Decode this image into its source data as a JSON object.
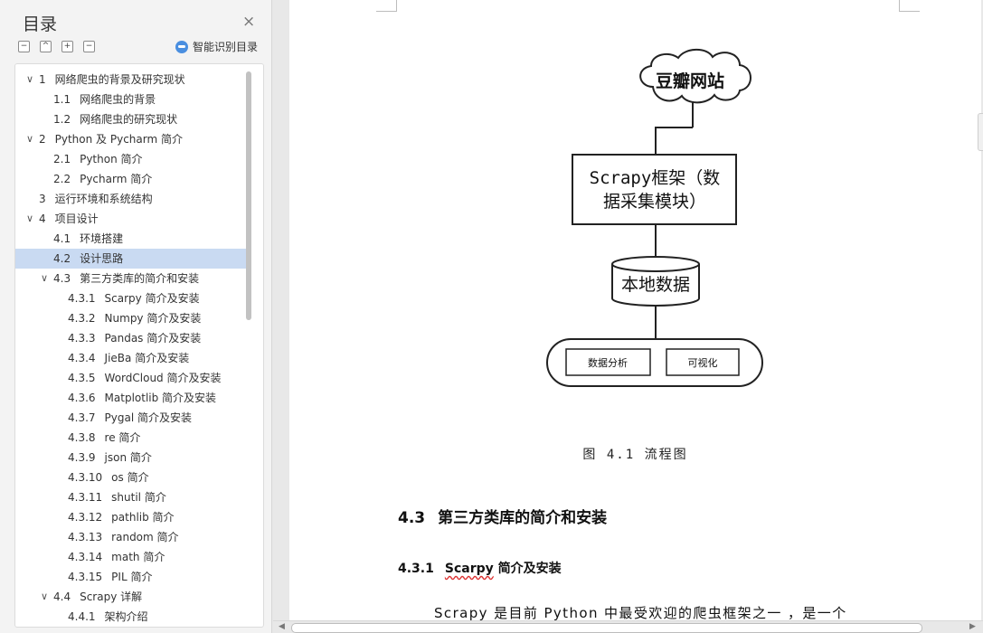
{
  "toc": {
    "title": "目录",
    "close_glyph": "×",
    "toolbar": {
      "collapse": "−",
      "up": "^",
      "expand": "+",
      "remove": "−"
    },
    "smart_label": "智能识别目录",
    "items": [
      {
        "level": 1,
        "chev": "∨",
        "num": "1",
        "label": "网络爬虫的背景及研究现状"
      },
      {
        "level": 2,
        "chev": "",
        "num": "1.1",
        "label": "网络爬虫的背景"
      },
      {
        "level": 2,
        "chev": "",
        "num": "1.2",
        "label": "网络爬虫的研究现状"
      },
      {
        "level": 1,
        "chev": "∨",
        "num": "2",
        "label": "Python 及 Pycharm 简介"
      },
      {
        "level": 2,
        "chev": "",
        "num": "2.1",
        "label": "Python 简介"
      },
      {
        "level": 2,
        "chev": "",
        "num": "2.2",
        "label": "Pycharm 简介"
      },
      {
        "level": 1,
        "chev": "",
        "num": "3",
        "label": "运行环境和系统结构"
      },
      {
        "level": 1,
        "chev": "∨",
        "num": "4",
        "label": "项目设计"
      },
      {
        "level": 2,
        "chev": "",
        "num": "4.1",
        "label": "环境搭建"
      },
      {
        "level": 2,
        "chev": "",
        "num": "4.2",
        "label": "设计思路",
        "selected": true
      },
      {
        "level": 2,
        "chev": "∨",
        "num": "4.3",
        "label": "第三方类库的简介和安装"
      },
      {
        "level": 3,
        "chev": "",
        "num": "4.3.1",
        "label": "Scarpy 简介及安装"
      },
      {
        "level": 3,
        "chev": "",
        "num": "4.3.2",
        "label": "Numpy 简介及安装"
      },
      {
        "level": 3,
        "chev": "",
        "num": "4.3.3",
        "label": "Pandas 简介及安装"
      },
      {
        "level": 3,
        "chev": "",
        "num": "4.3.4",
        "label": "JieBa 简介及安装"
      },
      {
        "level": 3,
        "chev": "",
        "num": "4.3.5",
        "label": "WordCloud 简介及安装"
      },
      {
        "level": 3,
        "chev": "",
        "num": "4.3.6",
        "label": "Matplotlib 简介及安装"
      },
      {
        "level": 3,
        "chev": "",
        "num": "4.3.7",
        "label": "Pygal 简介及安装"
      },
      {
        "level": 3,
        "chev": "",
        "num": "4.3.8",
        "label": "re 简介"
      },
      {
        "level": 3,
        "chev": "",
        "num": "4.3.9",
        "label": "json 简介"
      },
      {
        "level": 3,
        "chev": "",
        "num": "4.3.10",
        "label": "os 简介"
      },
      {
        "level": 3,
        "chev": "",
        "num": "4.3.11",
        "label": "shutil 简介"
      },
      {
        "level": 3,
        "chev": "",
        "num": "4.3.12",
        "label": "pathlib 简介"
      },
      {
        "level": 3,
        "chev": "",
        "num": "4.3.13",
        "label": "random 简介"
      },
      {
        "level": 3,
        "chev": "",
        "num": "4.3.14",
        "label": "math 简介"
      },
      {
        "level": 3,
        "chev": "",
        "num": "4.3.15",
        "label": "PIL 简介"
      },
      {
        "level": 2,
        "chev": "∨",
        "num": "4.4",
        "label": "Scrapy 详解"
      },
      {
        "level": 3,
        "chev": "",
        "num": "4.4.1",
        "label": "架构介绍"
      }
    ]
  },
  "document": {
    "flowchart": {
      "cloud_label": "豆瓣网站",
      "framework_line1": "Scrapy框架（数",
      "framework_line2": "据采集模块）",
      "db_label": "本地数据",
      "analysis_label": "数据分析",
      "viz_label": "可视化"
    },
    "caption": "图 4.1   流程图",
    "h2_num": "4.3",
    "h2_text": "第三方类库的简介和安装",
    "h3_num": "4.3.1",
    "h3_word": "Scarpy",
    "h3_text": " 简介及安装",
    "paragraph": "Scrapy 是目前 Python 中最受欢迎的爬虫框架之一 ，是一个"
  },
  "scroll": {
    "left_arrow": "◀",
    "right_arrow": "▶"
  }
}
